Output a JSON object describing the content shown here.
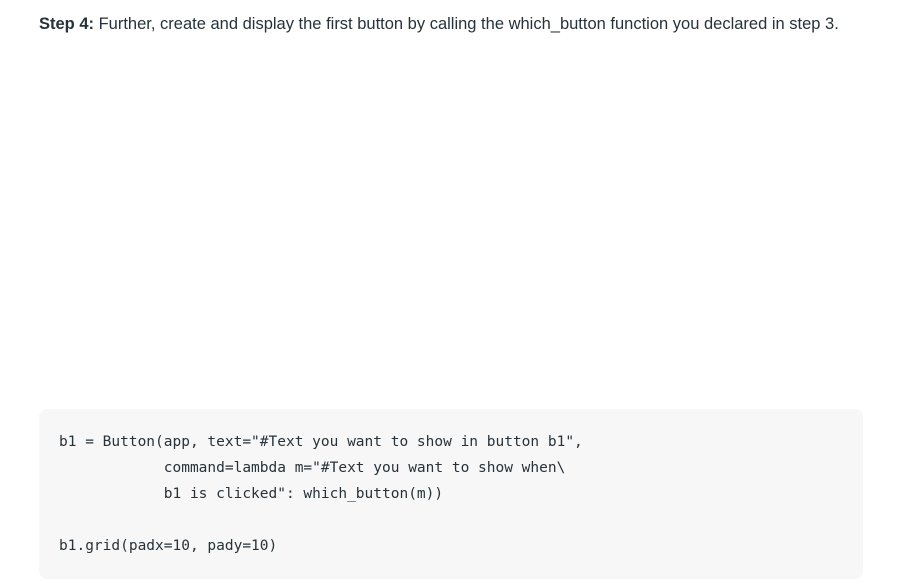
{
  "step": {
    "label": "Step 4:",
    "text": " Further, create and display the first button by calling the which_button function you declared in step 3."
  },
  "code": {
    "lines": [
      "b1 = Button(app, text=\"#Text you want to show in button b1\",",
      "            command=lambda m=\"#Text you want to show when\\",
      "            b1 is clicked\": which_button(m))",
      "",
      "b1.grid(padx=10, pady=10)"
    ]
  }
}
